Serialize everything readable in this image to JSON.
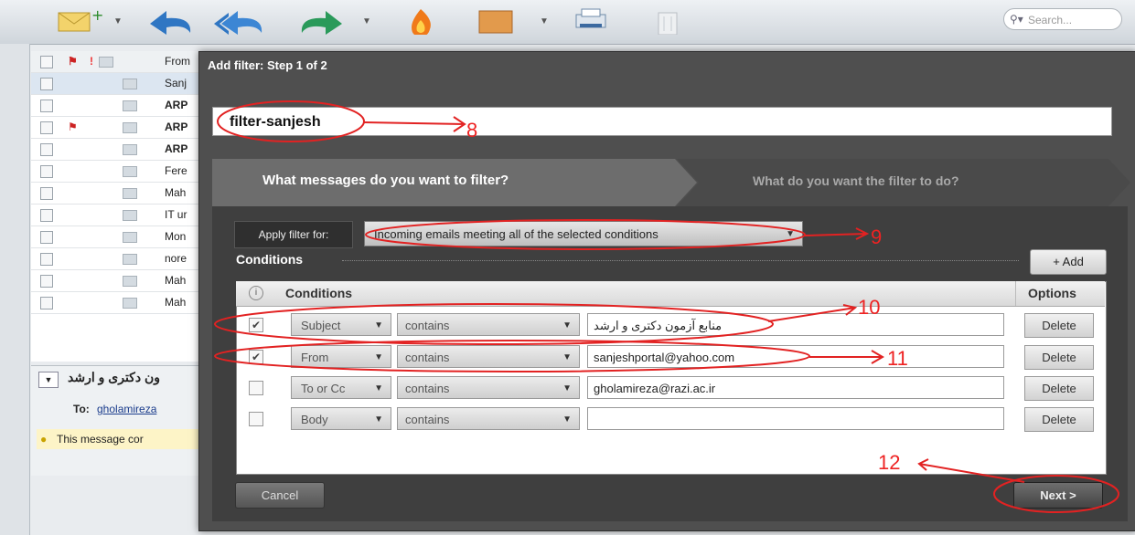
{
  "search": {
    "placeholder": "Search..."
  },
  "mail_list": {
    "header_from": "From",
    "rows": [
      {
        "sender": "Sanj"
      },
      {
        "sender": "ARP"
      },
      {
        "sender": "ARP"
      },
      {
        "sender": "ARP"
      },
      {
        "sender": "Fere"
      },
      {
        "sender": "Mah"
      },
      {
        "sender": "IT ur"
      },
      {
        "sender": "Mon"
      },
      {
        "sender": "nore"
      },
      {
        "sender": "Mah"
      },
      {
        "sender": "Mah"
      }
    ],
    "preview_subject": "ون دکتری و ارشد",
    "preview_to_label": "To:",
    "preview_to": "gholamireza",
    "warning": "This message cor"
  },
  "dialog": {
    "title": "Add filter: Step 1 of 2",
    "filter_name": "filter-sanjesh",
    "step1": "What messages do you want to filter?",
    "step2": "What do you want the filter to do?",
    "apply_label": "Apply filter for:",
    "apply_value": "Incoming emails meeting all of the selected conditions",
    "conditions_label": "Conditions",
    "add_label": "+ Add",
    "table_header_conditions": "Conditions",
    "table_header_options": "Options",
    "rows": [
      {
        "field": "Subject",
        "operator": "contains",
        "value": "منابع آزمون دکتری و ارشد",
        "checked": "✔",
        "delete": "Delete"
      },
      {
        "field": "From",
        "operator": "contains",
        "value": "sanjeshportal@yahoo.com",
        "checked": "✔",
        "delete": "Delete"
      },
      {
        "field": "To or Cc",
        "operator": "contains",
        "value": "gholamireza@razi.ac.ir",
        "checked": "",
        "delete": "Delete"
      },
      {
        "field": "Body",
        "operator": "contains",
        "value": "",
        "checked": "",
        "delete": "Delete"
      }
    ],
    "cancel_label": "Cancel",
    "next_label": "Next >"
  },
  "annotations": {
    "n8": "8",
    "n9": "9",
    "n10": "10",
    "n11": "11",
    "n12": "12"
  },
  "colors": {
    "annotation": "#e22222",
    "dialog_bg": "#4f4f4f"
  }
}
